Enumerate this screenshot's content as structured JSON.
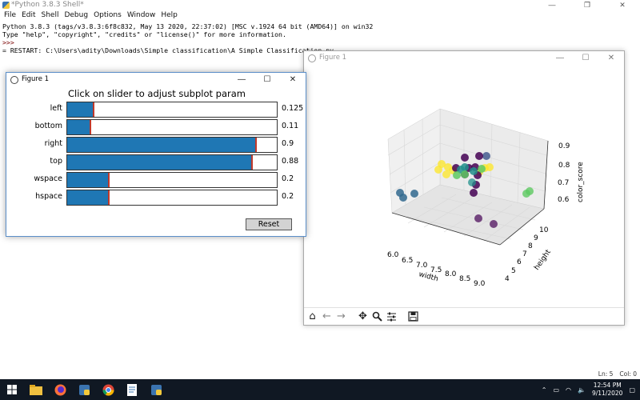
{
  "shell": {
    "title": "*Python 3.8.3 Shell*",
    "menu": [
      "File",
      "Edit",
      "Shell",
      "Debug",
      "Options",
      "Window",
      "Help"
    ],
    "lines": [
      "Python 3.8.3 (tags/v3.8.3:6f8c832, May 13 2020, 22:37:02) [MSC v.1924 64 bit (AMD64)] on win32",
      "Type \"help\", \"copyright\", \"credits\" or \"license()\" for more information.",
      ">>>",
      "= RESTART: C:\\Users\\adity\\Downloads\\Simple classification\\A Simple Classification.py"
    ],
    "status": {
      "line": "Ln: 5",
      "col": "Col: 0"
    }
  },
  "figure_3d": {
    "title": "Figure 1",
    "xlabel": "width",
    "ylabel": "height",
    "zlabel": "color_score",
    "x_ticks": [
      "6.0",
      "6.5",
      "7.0",
      "7.5",
      "8.0",
      "8.5",
      "9.0"
    ],
    "y_ticks": [
      "4",
      "5",
      "6",
      "7",
      "8",
      "9",
      "10"
    ],
    "z_ticks": [
      "0.6",
      "0.7",
      "0.8",
      "0.9"
    ],
    "toolbar": [
      "home-icon",
      "back-icon",
      "forward-icon",
      "pan-icon",
      "zoom-icon",
      "configure-icon",
      "save-icon"
    ]
  },
  "figure_sliders": {
    "title": "Figure 1",
    "heading": "Click on slider to adjust subplot param",
    "sliders": [
      {
        "label": "left",
        "value": "0.125",
        "fill": 0.125
      },
      {
        "label": "bottom",
        "value": "0.11",
        "fill": 0.11
      },
      {
        "label": "right",
        "value": "0.9",
        "fill": 0.9
      },
      {
        "label": "top",
        "value": "0.88",
        "fill": 0.88
      },
      {
        "label": "wspace",
        "value": "0.2",
        "fill": 0.2
      },
      {
        "label": "hspace",
        "value": "0.2",
        "fill": 0.2
      }
    ],
    "reset_label": "Reset"
  },
  "taskbar": {
    "clock_time": "12:54 PM",
    "clock_date": "9/11/2020"
  },
  "colors": {
    "slider_fill": "#1f77b4",
    "slider_marker": "#c0392b"
  }
}
